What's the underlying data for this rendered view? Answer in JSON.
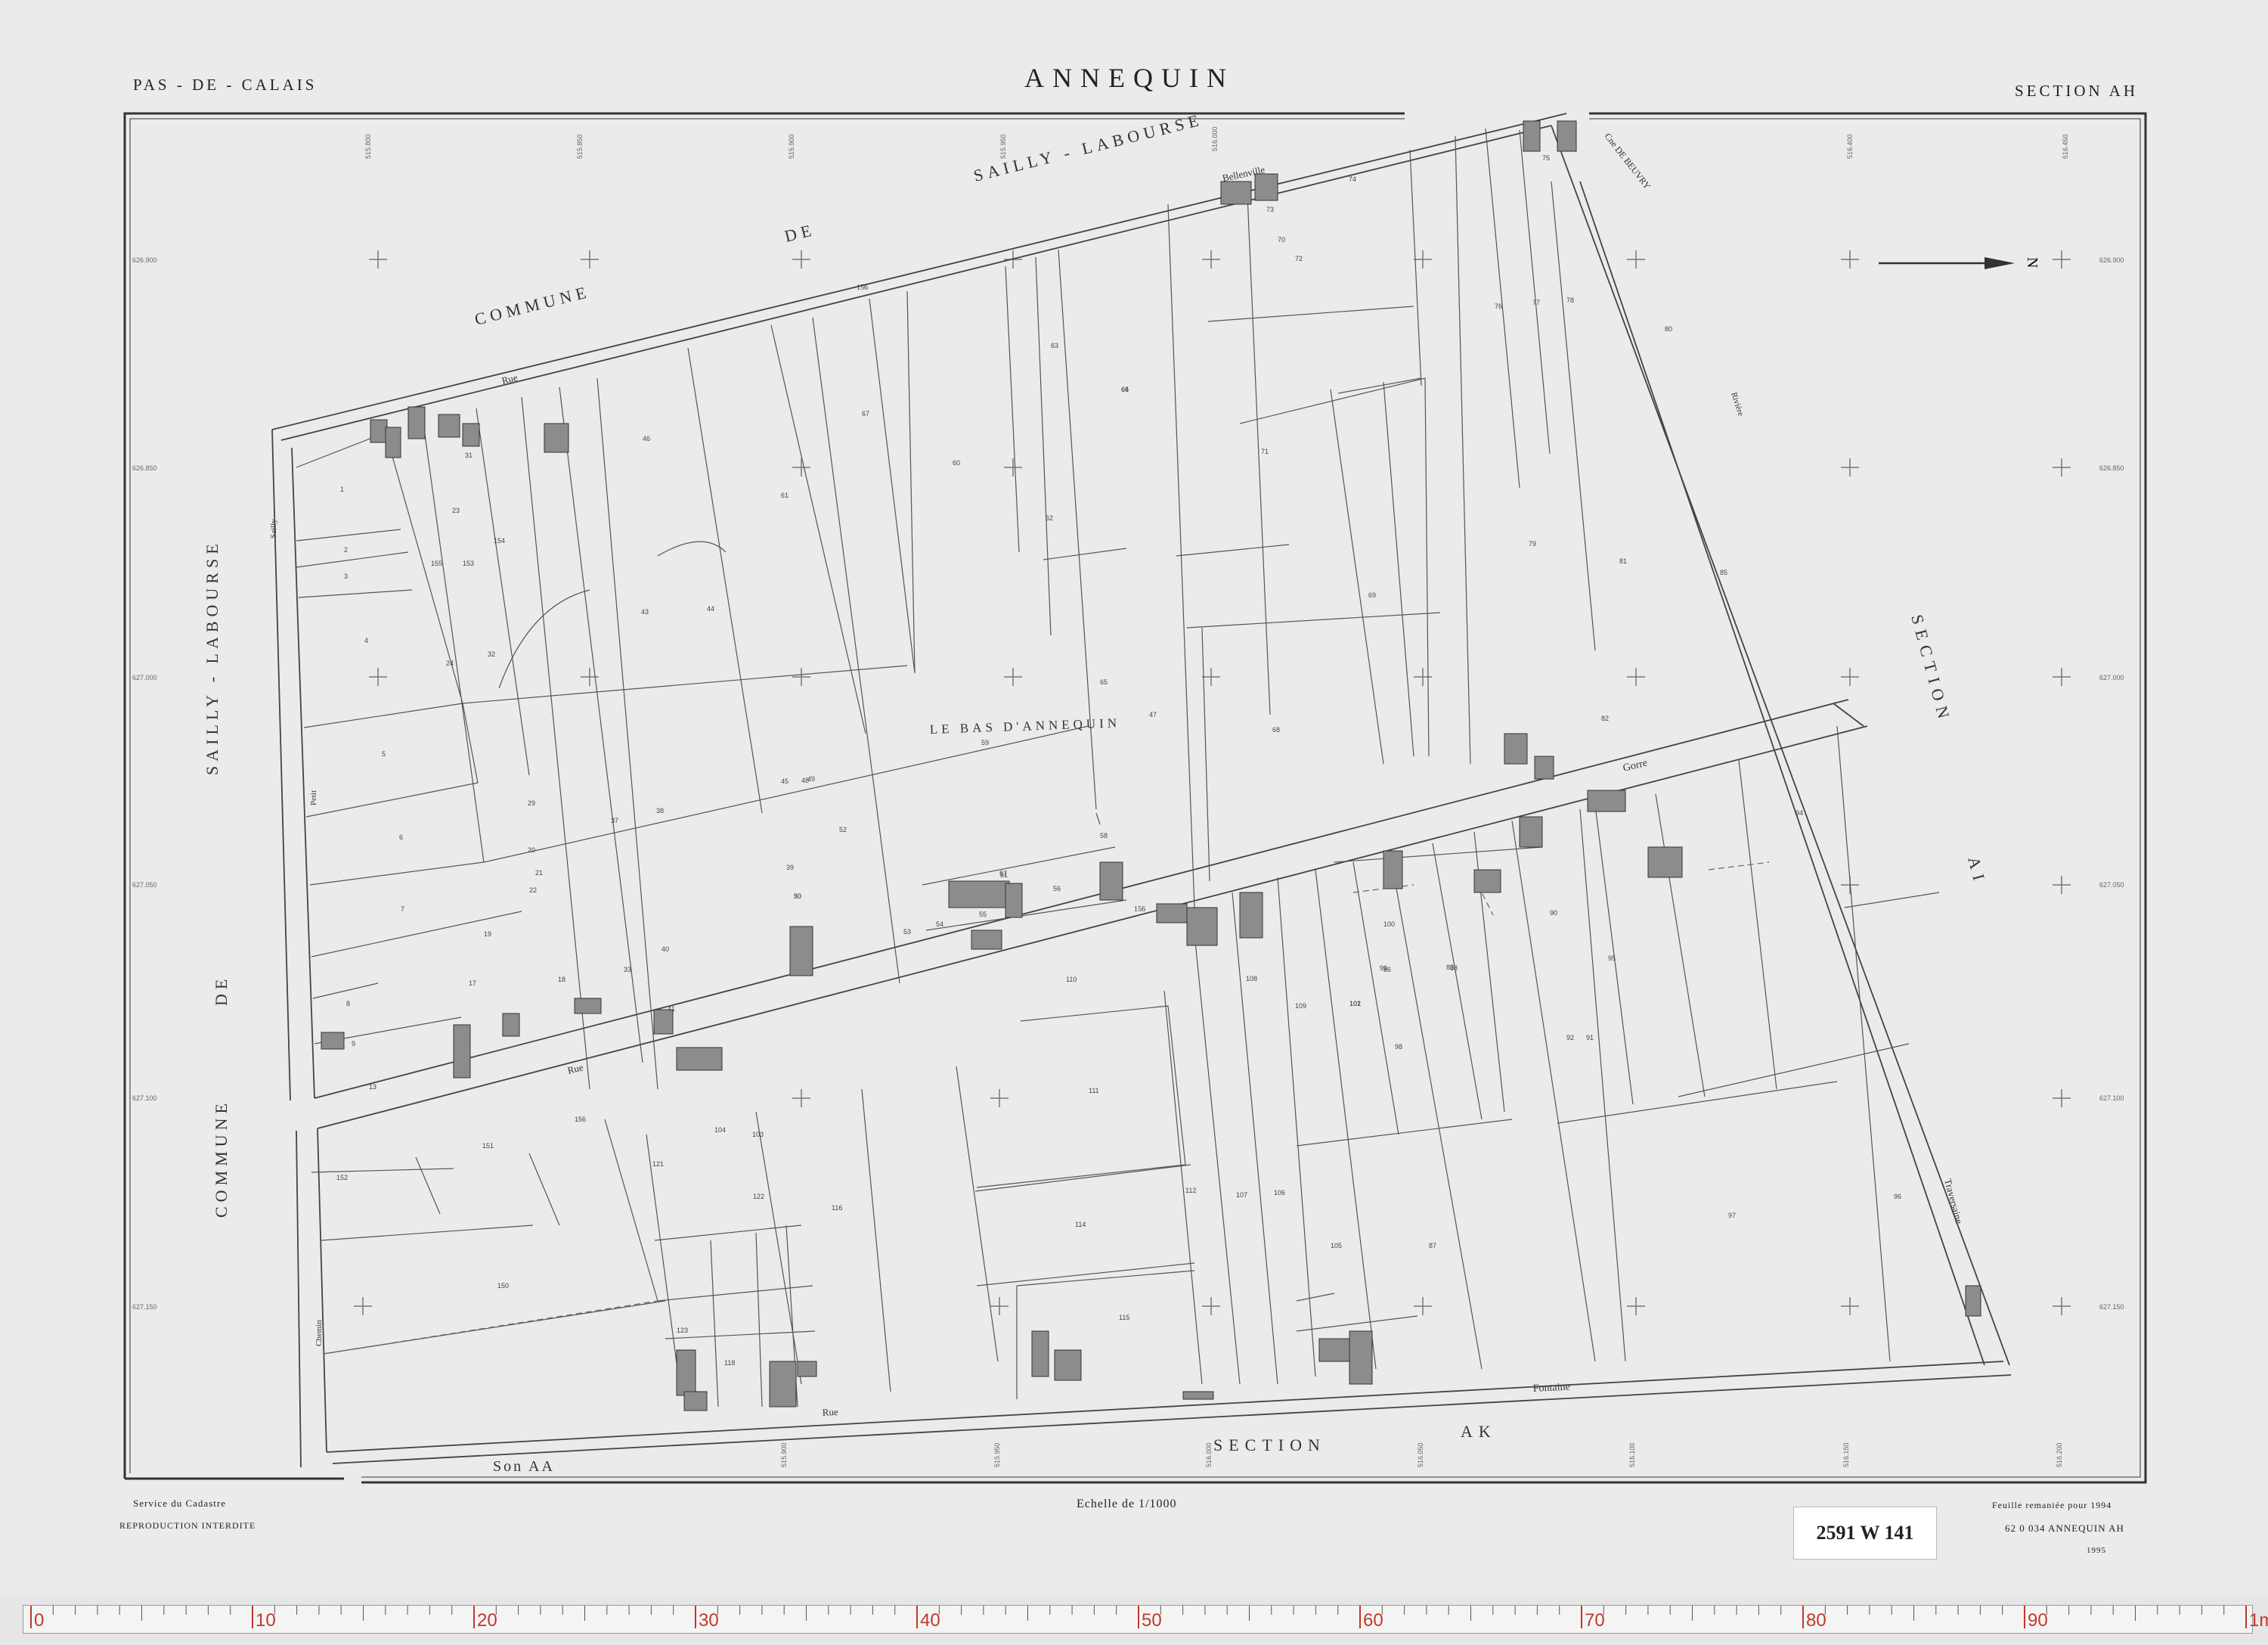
{
  "header": {
    "department": "PAS - DE - CALAIS",
    "commune": "ANNEQUIN",
    "section": "SECTION   AH"
  },
  "map_labels": {
    "commune_top": "COMMUNE",
    "de_top": "DE",
    "sailly_top": "SAILLY - LABOURSE",
    "commune_left": "COMMUNE",
    "de_left": "DE",
    "sailly_left": "SAILLY - LABOURSE",
    "section_ai_label": "SECTION",
    "section_ai_letters": "AI",
    "section_ak_label": "SECTION",
    "section_ak_letters": "AK",
    "son_aa": "Son  AA",
    "locality": "LE  BAS  D'ANNEQUIN",
    "bellenville": "Bellenville",
    "cne_beuvry": "Cne  DE  BEUVRY",
    "rue_top": "Rue",
    "rue_mid": "Rue",
    "rue_bottom": "Rue",
    "gorre": "Gorre",
    "fontaine": "Fontaine",
    "traversaine": "Traversaine",
    "sailly_vertical": "Sailly",
    "petit": "Petit",
    "chemin": "Chemin",
    "riviere": "Rivière",
    "north": "N"
  },
  "parcels": [
    {
      "id": "1",
      "v": "1"
    },
    {
      "id": "2",
      "v": "2"
    },
    {
      "id": "3",
      "v": "3"
    },
    {
      "id": "4",
      "v": "4"
    },
    {
      "id": "5",
      "v": "5"
    },
    {
      "id": "6",
      "v": "6"
    },
    {
      "id": "7",
      "v": "7"
    },
    {
      "id": "8",
      "v": "8"
    },
    {
      "id": "9",
      "v": "9"
    },
    {
      "id": "13",
      "v": "13"
    },
    {
      "id": "17",
      "v": "17"
    },
    {
      "id": "18",
      "v": "18"
    },
    {
      "id": "19",
      "v": "19"
    },
    {
      "id": "20",
      "v": "20"
    },
    {
      "id": "21",
      "v": "21"
    },
    {
      "id": "22",
      "v": "22"
    },
    {
      "id": "23",
      "v": "23"
    },
    {
      "id": "24",
      "v": "24"
    },
    {
      "id": "29",
      "v": "29"
    },
    {
      "id": "30",
      "v": "30"
    },
    {
      "id": "31",
      "v": "31"
    },
    {
      "id": "32",
      "v": "32"
    },
    {
      "id": "33",
      "v": "33"
    },
    {
      "id": "37",
      "v": "37"
    },
    {
      "id": "38",
      "v": "38"
    },
    {
      "id": "39",
      "v": "39"
    },
    {
      "id": "40",
      "v": "40"
    },
    {
      "id": "41",
      "v": "41"
    },
    {
      "id": "43",
      "v": "43"
    },
    {
      "id": "44",
      "v": "44"
    },
    {
      "id": "45",
      "v": "45"
    },
    {
      "id": "46",
      "v": "46"
    },
    {
      "id": "47",
      "v": "47"
    },
    {
      "id": "48",
      "v": "48"
    },
    {
      "id": "49",
      "v": "49"
    },
    {
      "id": "50",
      "v": "50"
    },
    {
      "id": "51",
      "v": "51"
    },
    {
      "id": "52",
      "v": "52"
    },
    {
      "id": "53",
      "v": "53"
    },
    {
      "id": "54",
      "v": "54"
    },
    {
      "id": "55",
      "v": "55"
    },
    {
      "id": "56",
      "v": "56"
    },
    {
      "id": "57",
      "v": "57"
    },
    {
      "id": "58",
      "v": "58"
    },
    {
      "id": "59",
      "v": "59"
    },
    {
      "id": "60",
      "v": "60"
    },
    {
      "id": "61",
      "v": "61"
    },
    {
      "id": "62",
      "v": "62"
    },
    {
      "id": "63",
      "v": "63"
    },
    {
      "id": "64",
      "v": "64"
    },
    {
      "id": "65",
      "v": "65"
    },
    {
      "id": "66",
      "v": "66"
    },
    {
      "id": "67",
      "v": "67"
    },
    {
      "id": "68",
      "v": "68"
    },
    {
      "id": "69",
      "v": "69"
    },
    {
      "id": "70",
      "v": "70"
    },
    {
      "id": "71",
      "v": "71"
    },
    {
      "id": "72",
      "v": "72"
    },
    {
      "id": "73",
      "v": "73"
    },
    {
      "id": "74",
      "v": "74"
    },
    {
      "id": "75",
      "v": "75"
    },
    {
      "id": "76",
      "v": "76"
    },
    {
      "id": "77",
      "v": "77"
    },
    {
      "id": "78",
      "v": "78"
    },
    {
      "id": "79",
      "v": "79"
    },
    {
      "id": "80",
      "v": "80"
    },
    {
      "id": "81",
      "v": "81"
    },
    {
      "id": "82",
      "v": "82"
    },
    {
      "id": "85",
      "v": "85"
    },
    {
      "id": "86",
      "v": "86"
    },
    {
      "id": "87",
      "v": "87"
    },
    {
      "id": "88",
      "v": "88"
    },
    {
      "id": "89",
      "v": "89"
    },
    {
      "id": "90",
      "v": "90"
    },
    {
      "id": "91",
      "v": "91"
    },
    {
      "id": "92",
      "v": "92"
    },
    {
      "id": "94",
      "v": "94"
    },
    {
      "id": "95",
      "v": "95"
    },
    {
      "id": "96",
      "v": "96"
    },
    {
      "id": "97",
      "v": "97"
    },
    {
      "id": "98",
      "v": "98"
    },
    {
      "id": "99",
      "v": "99"
    },
    {
      "id": "100",
      "v": "100"
    },
    {
      "id": "101",
      "v": "101"
    },
    {
      "id": "102",
      "v": "102"
    },
    {
      "id": "103",
      "v": "103"
    },
    {
      "id": "104",
      "v": "104"
    },
    {
      "id": "105",
      "v": "105"
    },
    {
      "id": "106",
      "v": "106"
    },
    {
      "id": "107",
      "v": "107"
    },
    {
      "id": "108",
      "v": "108"
    },
    {
      "id": "109",
      "v": "109"
    },
    {
      "id": "110",
      "v": "110"
    },
    {
      "id": "111",
      "v": "111"
    },
    {
      "id": "112",
      "v": "112"
    },
    {
      "id": "114",
      "v": "114"
    },
    {
      "id": "115",
      "v": "115"
    },
    {
      "id": "116",
      "v": "116"
    },
    {
      "id": "118",
      "v": "118"
    },
    {
      "id": "121",
      "v": "121"
    },
    {
      "id": "122",
      "v": "122"
    },
    {
      "id": "123",
      "v": "123"
    },
    {
      "id": "150",
      "v": "150"
    },
    {
      "id": "151",
      "v": "151"
    },
    {
      "id": "152",
      "v": "152"
    },
    {
      "id": "153",
      "v": "153"
    },
    {
      "id": "154",
      "v": "154"
    },
    {
      "id": "155",
      "v": "155"
    },
    {
      "id": "156",
      "v": "156"
    }
  ],
  "road_codes": {
    "c156_top": "156",
    "c156_mid": "156"
  },
  "footer": {
    "service": "Service du Cadastre",
    "reproduction": "REPRODUCTION  INTERDITE",
    "scale": "Echelle de 1/1000",
    "remaniee": "Feuille remaniée pour 1994",
    "ref": "62 0 034  ANNEQUIN  AH",
    "year": "1995"
  },
  "archive_stamp": "2591 W 141",
  "ruler": {
    "labels": [
      "0",
      "10",
      "20",
      "30",
      "40",
      "50",
      "60",
      "70",
      "80",
      "90",
      "1m"
    ]
  },
  "colors": {
    "paper": "#ebebeb",
    "line": "#444444",
    "building": "#8c8c8c",
    "ruler_mark": "#c0392b"
  }
}
